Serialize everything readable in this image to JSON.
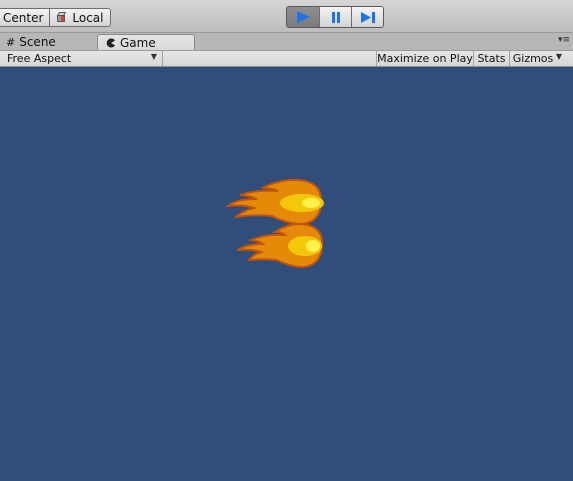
{
  "toolbar": {
    "pivot_center_label": "Center",
    "pivot_space_label": "Local",
    "cube_icon": "pivot-cube-icon",
    "play_icon": "play-icon",
    "pause_icon": "pause-icon",
    "step_icon": "step-icon",
    "play_active": true,
    "play_color": "#1e73e8"
  },
  "tabs": {
    "scene_label": "Scene",
    "scene_icon": "grid-icon",
    "game_label": "Game",
    "game_icon": "pacman-icon",
    "menu_icon": "tab-menu-icon"
  },
  "game_bar": {
    "aspect_label": "Free Aspect",
    "maximize_label": "Maximize on Play",
    "stats_label": "Stats",
    "gizmos_label": "Gizmos"
  },
  "game_view": {
    "background_color": "#314d79",
    "sprites": [
      "fireball",
      "fireball"
    ],
    "fire_colors": {
      "outline": "#c2530a",
      "body": "#e58a08",
      "core": "#f3c80a",
      "highlight": "#fff24a"
    }
  }
}
